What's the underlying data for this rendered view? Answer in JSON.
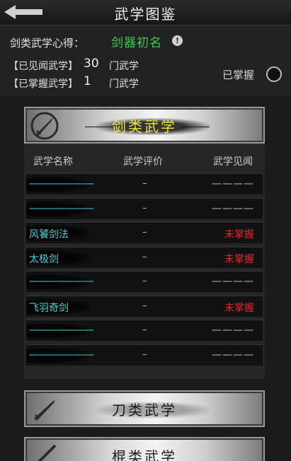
{
  "header": {
    "title": "武学图鉴"
  },
  "summary": {
    "insight_label": "剑类武学心得：",
    "insight_value": "剑器初名",
    "info_icon_glyph": "!",
    "seen_label": "【已见闻武学】",
    "seen_count": "30",
    "seen_unit": "门武学",
    "mastered_label": "【已掌握武学】",
    "mastered_count": "1",
    "mastered_unit": "门武学",
    "filter_label": "已掌握"
  },
  "category_active": {
    "label": "剑类武学",
    "icon": "sword-icon"
  },
  "columns": {
    "name": "武学名称",
    "rating": "武学评价",
    "seen": "武学见闻"
  },
  "rows": [
    {
      "name": "———————",
      "rating": "–",
      "seen": "————",
      "seen_status": "unknown"
    },
    {
      "name": "———————",
      "rating": "–",
      "seen": "————",
      "seen_status": "unknown"
    },
    {
      "name": "风饕剑法",
      "rating": "–",
      "seen": "未掌握",
      "seen_status": "not-mastered"
    },
    {
      "name": "太极剑",
      "rating": "–",
      "seen": "未掌握",
      "seen_status": "not-mastered"
    },
    {
      "name": "———————",
      "rating": "–",
      "seen": "————",
      "seen_status": "unknown"
    },
    {
      "name": "飞羽奇剑",
      "rating": "–",
      "seen": "未掌握",
      "seen_status": "not-mastered"
    },
    {
      "name": "———————",
      "rating": "–",
      "seen": "————",
      "seen_status": "unknown"
    },
    {
      "name": "———————",
      "rating": "–",
      "seen": "————",
      "seen_status": "unknown"
    }
  ],
  "categories_collapsed": [
    {
      "label": "刀类武学",
      "icon": "blade-icon"
    },
    {
      "label": "棍类武学",
      "icon": "staff-icon"
    }
  ],
  "colors": {
    "accent_green": "#38d04a",
    "name_cyan": "#4fd0d8",
    "status_red": "#e02a2a",
    "banner_title_yellow": "#f4e43a"
  }
}
